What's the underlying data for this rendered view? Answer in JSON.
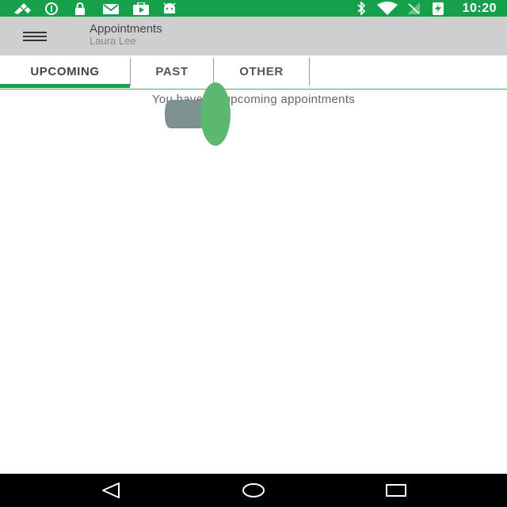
{
  "status_bar": {
    "time": "10:20",
    "left_icons": [
      "satellite-icon",
      "info-icon",
      "lock-icon",
      "mail-icon",
      "play-store-icon",
      "android-icon"
    ],
    "right_icons": [
      "bluetooth-icon",
      "wifi-icon",
      "no-signal-icon",
      "battery-charging-icon"
    ]
  },
  "app_bar": {
    "title": "Appointments",
    "subtitle": "Laura Lee",
    "menu_icon": "hamburger-menu-icon"
  },
  "tabs": [
    {
      "label": "UPCOMING",
      "active": true
    },
    {
      "label": "PAST",
      "active": false
    },
    {
      "label": "OTHER",
      "active": false
    }
  ],
  "content": {
    "empty_message": "You have no upcoming appointments"
  },
  "nav_bar": {
    "buttons": [
      "back-icon",
      "home-icon",
      "recents-icon"
    ]
  },
  "colors": {
    "status_bar": "#17a04b",
    "app_bar": "#cfcfcf",
    "accent": "#17a04b",
    "overlay_green": "#5cb870",
    "overlay_gray": "#7e9190"
  }
}
